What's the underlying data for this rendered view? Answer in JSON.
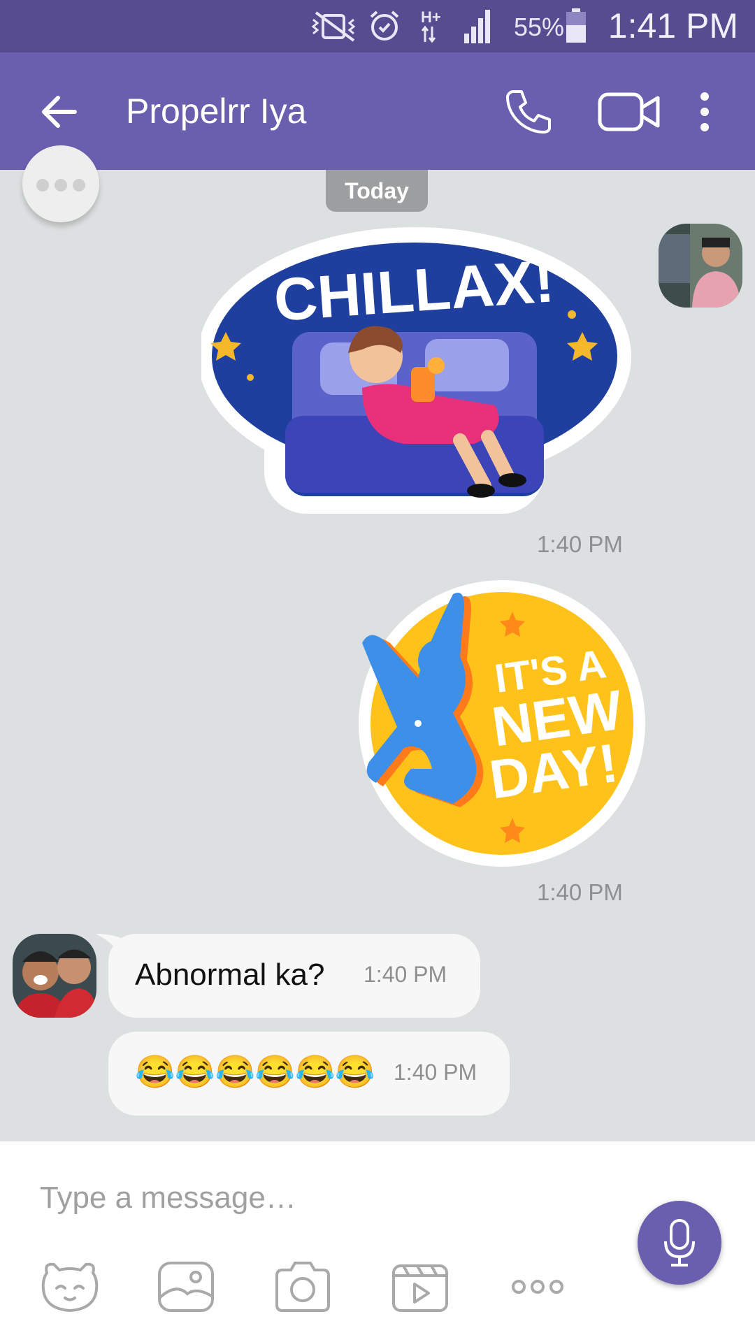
{
  "status_bar": {
    "battery": "55%",
    "time": "1:41 PM"
  },
  "header": {
    "title": "Propelrr Iya"
  },
  "chat": {
    "date_pill": "Today",
    "messages": [
      {
        "type": "sticker",
        "sender": "me",
        "sticker_text": "CHILLAX!",
        "time": "1:40 PM"
      },
      {
        "type": "sticker",
        "sender": "me",
        "sticker_text": [
          "IT'S A",
          "NEW",
          "DAY!"
        ],
        "time": "1:40 PM"
      },
      {
        "type": "text",
        "sender": "contact",
        "text": "Abnormal ka?",
        "time": "1:40 PM"
      },
      {
        "type": "text",
        "sender": "contact",
        "text": "😂😂😂😂😂😂",
        "time": "1:40 PM"
      }
    ]
  },
  "composer": {
    "placeholder": "Type a message…"
  },
  "colors": {
    "status_bar": "#574c8f",
    "app_bar": "#6a5eae",
    "chat_bg": "#dde0e0",
    "bubble": "#f7f7f7",
    "accent": "#6a5eae"
  },
  "icons": [
    "back-arrow-icon",
    "phone-icon",
    "video-call-icon",
    "more-vert-icon",
    "mic-icon",
    "sticker-icon",
    "gallery-icon",
    "camera-icon",
    "gif-video-icon",
    "more-horiz-icon"
  ]
}
